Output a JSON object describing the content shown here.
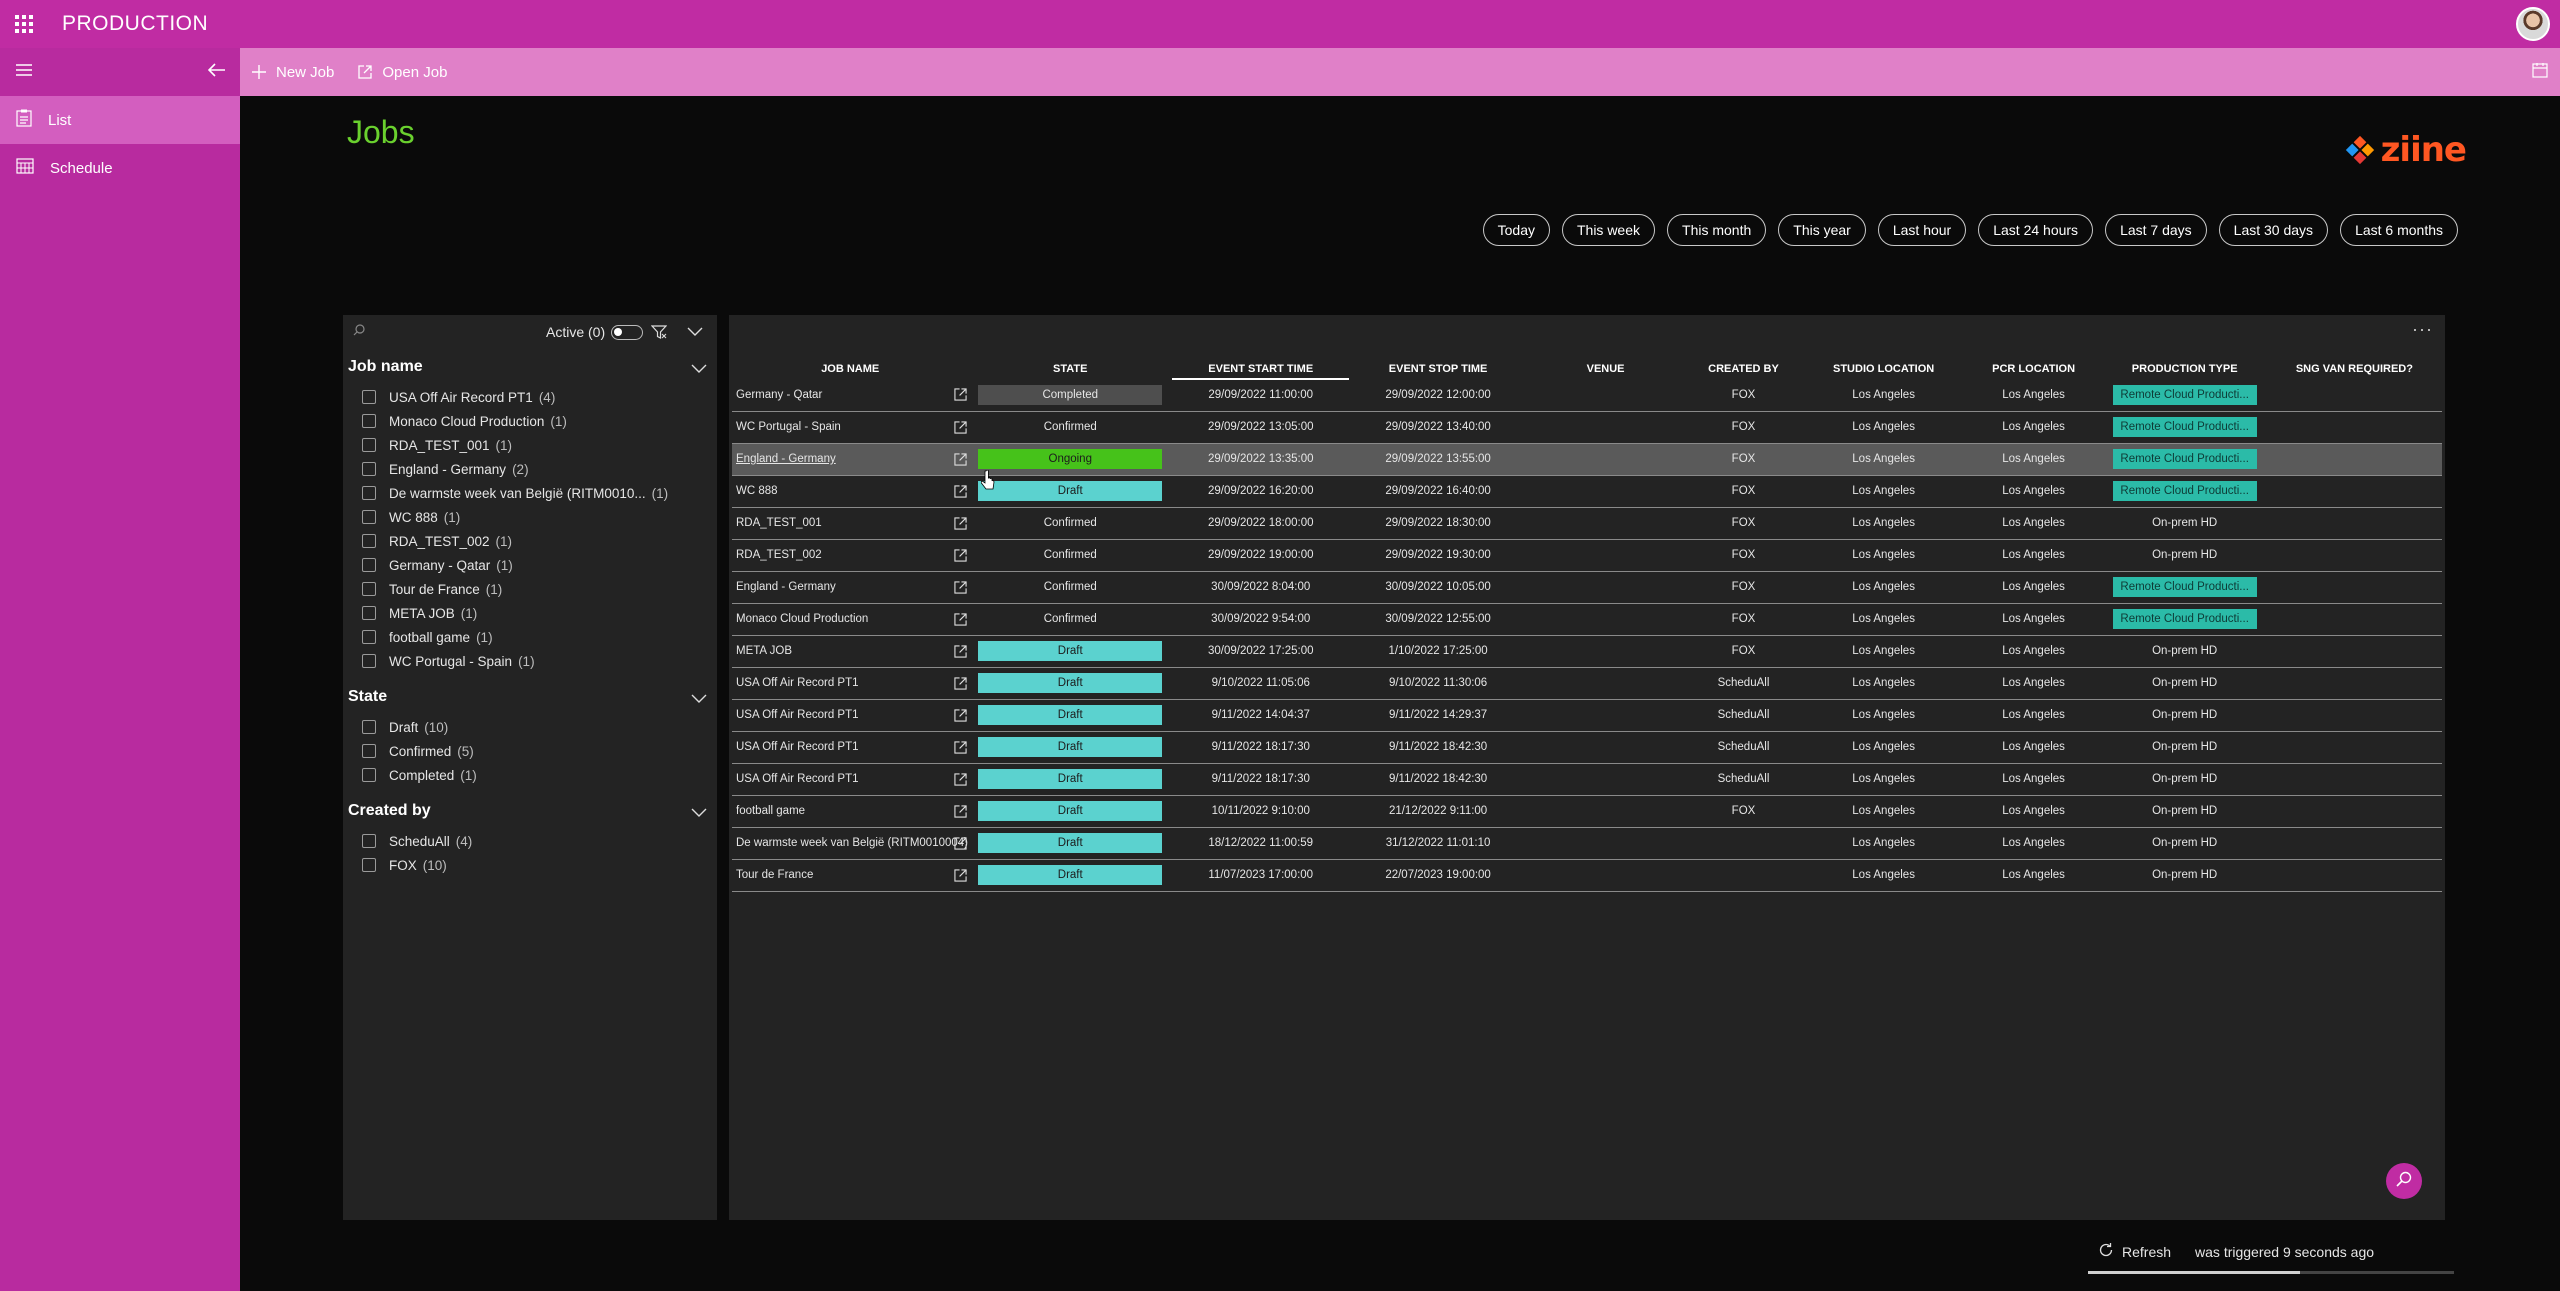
{
  "app": {
    "title": "PRODUCTION"
  },
  "commands": {
    "new_job": "New Job",
    "open_job": "Open Job"
  },
  "nav": [
    {
      "label": "List",
      "icon": "clipboard-list-icon"
    },
    {
      "label": "Schedule",
      "icon": "calendar-icon"
    }
  ],
  "page": {
    "title": "Jobs",
    "logo_text": "ziine"
  },
  "periods": [
    "Today",
    "This week",
    "This month",
    "This year",
    "Last hour",
    "Last 24 hours",
    "Last 7 days",
    "Last 30 days",
    "Last 6 months"
  ],
  "filters": {
    "active_label": "Active (0)",
    "sections": [
      {
        "title": "Job name",
        "items": [
          {
            "label": "USA Off Air Record PT1",
            "count": "(4)"
          },
          {
            "label": "Monaco Cloud Production",
            "count": "(1)"
          },
          {
            "label": "RDA_TEST_001",
            "count": "(1)"
          },
          {
            "label": "England - Germany",
            "count": "(2)"
          },
          {
            "label": "De warmste week van België (RITM0010...",
            "count": "(1)"
          },
          {
            "label": "WC 888",
            "count": "(1)"
          },
          {
            "label": "RDA_TEST_002",
            "count": "(1)"
          },
          {
            "label": "Germany - Qatar",
            "count": "(1)"
          },
          {
            "label": "Tour de France",
            "count": "(1)"
          },
          {
            "label": "META JOB",
            "count": "(1)"
          },
          {
            "label": "football game",
            "count": "(1)"
          },
          {
            "label": "WC Portugal - Spain",
            "count": "(1)"
          }
        ]
      },
      {
        "title": "State",
        "items": [
          {
            "label": "Draft",
            "count": "(10)"
          },
          {
            "label": "Confirmed",
            "count": "(5)"
          },
          {
            "label": "Completed",
            "count": "(1)"
          }
        ]
      },
      {
        "title": "Created by",
        "items": [
          {
            "label": "ScheduAll",
            "count": "(4)"
          },
          {
            "label": "FOX",
            "count": "(10)"
          }
        ]
      }
    ]
  },
  "grid": {
    "columns": [
      "Job name",
      "",
      "State",
      "Event start time",
      "Event stop time",
      "Venue",
      "Created by",
      "Studio location",
      "PCR location",
      "Production type",
      "SNG van required?"
    ],
    "rows": [
      {
        "name": "Germany - Qatar",
        "state": "Completed",
        "start": "29/09/2022 11:00:00",
        "stop": "29/09/2022 12:00:00",
        "venue": "",
        "created_by": "FOX",
        "studio": "Los Angeles",
        "pcr": "Los Angeles",
        "ptype": "Remote Cloud Producti...",
        "sng": ""
      },
      {
        "name": "WC Portugal - Spain",
        "state": "Confirmed",
        "start": "29/09/2022 13:05:00",
        "stop": "29/09/2022 13:40:00",
        "venue": "",
        "created_by": "FOX",
        "studio": "Los Angeles",
        "pcr": "Los Angeles",
        "ptype": "Remote Cloud Producti...",
        "sng": ""
      },
      {
        "name": "England - Germany",
        "state": "Ongoing",
        "start": "29/09/2022 13:35:00",
        "stop": "29/09/2022 13:55:00",
        "venue": "",
        "created_by": "FOX",
        "studio": "Los Angeles",
        "pcr": "Los Angeles",
        "ptype": "Remote Cloud Producti...",
        "sng": "",
        "highlight": true
      },
      {
        "name": "WC 888",
        "state": "Draft",
        "start": "29/09/2022 16:20:00",
        "stop": "29/09/2022 16:40:00",
        "venue": "",
        "created_by": "FOX",
        "studio": "Los Angeles",
        "pcr": "Los Angeles",
        "ptype": "Remote Cloud Producti...",
        "sng": ""
      },
      {
        "name": "RDA_TEST_001",
        "state": "Confirmed",
        "start": "29/09/2022 18:00:00",
        "stop": "29/09/2022 18:30:00",
        "venue": "",
        "created_by": "FOX",
        "studio": "Los Angeles",
        "pcr": "Los Angeles",
        "ptype": "On-prem HD",
        "sng": ""
      },
      {
        "name": "RDA_TEST_002",
        "state": "Confirmed",
        "start": "29/09/2022 19:00:00",
        "stop": "29/09/2022 19:30:00",
        "venue": "",
        "created_by": "FOX",
        "studio": "Los Angeles",
        "pcr": "Los Angeles",
        "ptype": "On-prem HD",
        "sng": ""
      },
      {
        "name": "England - Germany",
        "state": "Confirmed",
        "start": "30/09/2022 8:04:00",
        "stop": "30/09/2022 10:05:00",
        "venue": "",
        "created_by": "FOX",
        "studio": "Los Angeles",
        "pcr": "Los Angeles",
        "ptype": "Remote Cloud Producti...",
        "sng": ""
      },
      {
        "name": "Monaco Cloud Production",
        "state": "Confirmed",
        "start": "30/09/2022 9:54:00",
        "stop": "30/09/2022 12:55:00",
        "venue": "",
        "created_by": "FOX",
        "studio": "Los Angeles",
        "pcr": "Los Angeles",
        "ptype": "Remote Cloud Producti...",
        "sng": ""
      },
      {
        "name": "META JOB",
        "state": "Draft",
        "start": "30/09/2022 17:25:00",
        "stop": "1/10/2022 17:25:00",
        "venue": "",
        "created_by": "FOX",
        "studio": "Los Angeles",
        "pcr": "Los Angeles",
        "ptype": "On-prem HD",
        "sng": ""
      },
      {
        "name": "USA Off Air Record PT1",
        "state": "Draft",
        "start": "9/10/2022 11:05:06",
        "stop": "9/10/2022 11:30:06",
        "venue": "",
        "created_by": "ScheduAll",
        "studio": "Los Angeles",
        "pcr": "Los Angeles",
        "ptype": "On-prem HD",
        "sng": ""
      },
      {
        "name": "USA Off Air Record PT1",
        "state": "Draft",
        "start": "9/11/2022 14:04:37",
        "stop": "9/11/2022 14:29:37",
        "venue": "",
        "created_by": "ScheduAll",
        "studio": "Los Angeles",
        "pcr": "Los Angeles",
        "ptype": "On-prem HD",
        "sng": ""
      },
      {
        "name": "USA Off Air Record PT1",
        "state": "Draft",
        "start": "9/11/2022 18:17:30",
        "stop": "9/11/2022 18:42:30",
        "venue": "",
        "created_by": "ScheduAll",
        "studio": "Los Angeles",
        "pcr": "Los Angeles",
        "ptype": "On-prem HD",
        "sng": ""
      },
      {
        "name": "USA Off Air Record PT1",
        "state": "Draft",
        "start": "9/11/2022 18:17:30",
        "stop": "9/11/2022 18:42:30",
        "venue": "",
        "created_by": "ScheduAll",
        "studio": "Los Angeles",
        "pcr": "Los Angeles",
        "ptype": "On-prem HD",
        "sng": ""
      },
      {
        "name": "football game",
        "state": "Draft",
        "start": "10/11/2022 9:10:00",
        "stop": "21/12/2022 9:11:00",
        "venue": "",
        "created_by": "FOX",
        "studio": "Los Angeles",
        "pcr": "Los Angeles",
        "ptype": "On-prem HD",
        "sng": ""
      },
      {
        "name": "De warmste week van België (RITM0010004)",
        "state": "Draft",
        "start": "18/12/2022 11:00:59",
        "stop": "31/12/2022 11:01:10",
        "venue": "",
        "created_by": "",
        "studio": "Los Angeles",
        "pcr": "Los Angeles",
        "ptype": "On-prem HD",
        "sng": ""
      },
      {
        "name": "Tour de France",
        "state": "Draft",
        "start": "11/07/2023 17:00:00",
        "stop": "22/07/2023 19:00:00",
        "venue": "",
        "created_by": "",
        "studio": "Los Angeles",
        "pcr": "Los Angeles",
        "ptype": "On-prem HD",
        "sng": ""
      }
    ]
  },
  "footer": {
    "refresh_label": "Refresh",
    "refresh_status": "was triggered 9 seconds ago",
    "progress": 0.58
  },
  "colors": {
    "brand": "#c02ca3",
    "title_green": "#6ad12e",
    "draft": "#5bd2cf",
    "ongoing": "#46c21a",
    "remote_cloud": "#2bbba8",
    "logo": "#ff5722"
  }
}
